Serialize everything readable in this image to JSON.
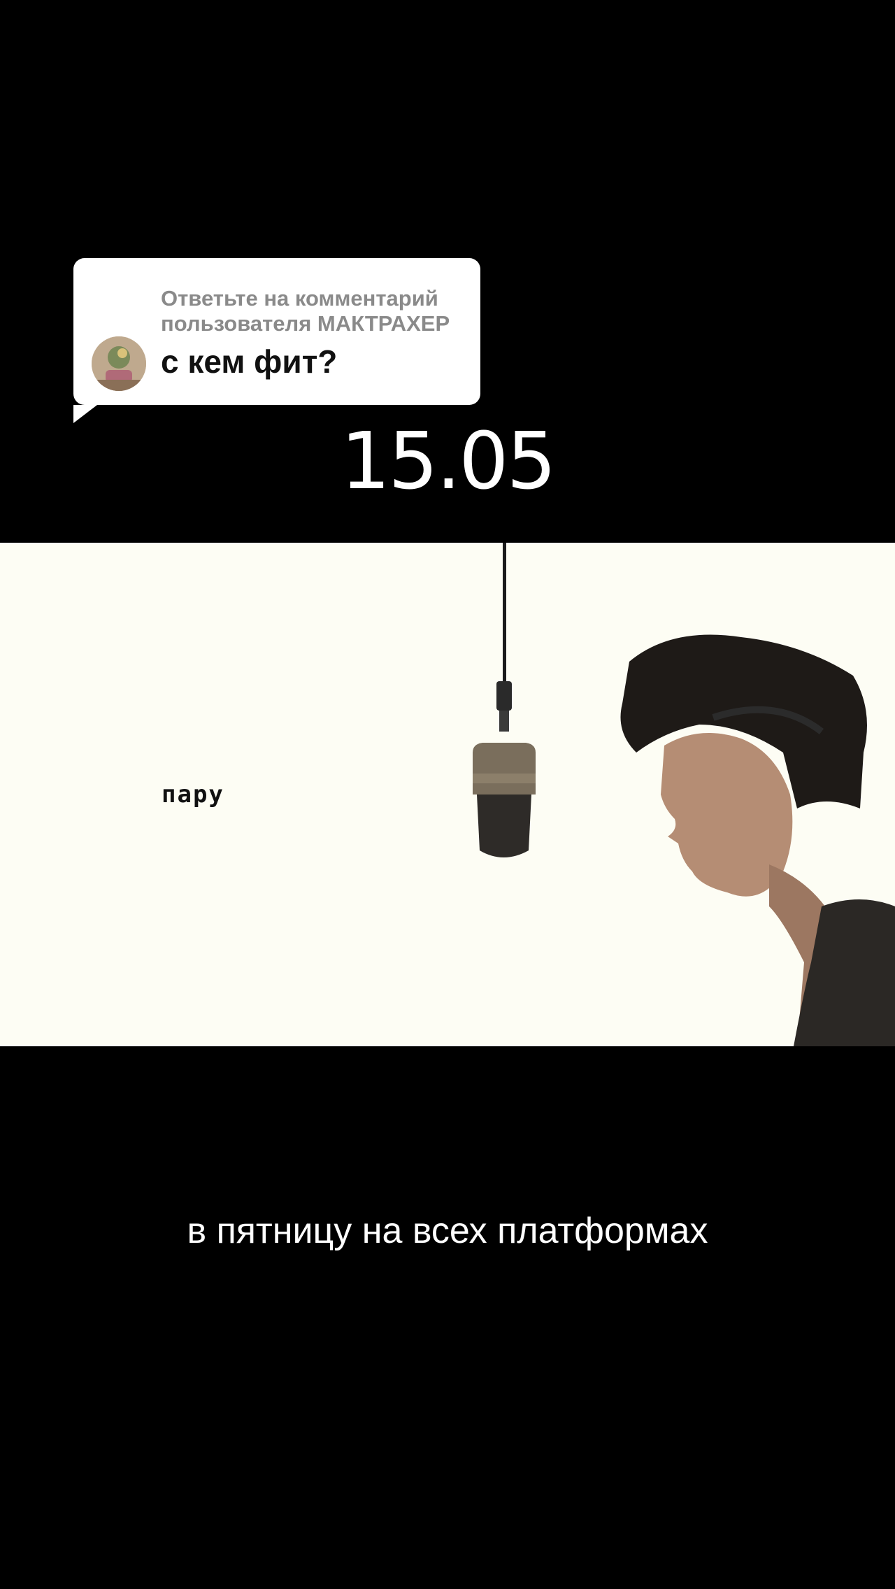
{
  "reply": {
    "header": "Ответьте на комментарий пользователя МАКТРАХЕР",
    "comment": "с кем фит?"
  },
  "overlay": {
    "date": "15.05"
  },
  "video": {
    "lyric": "пару"
  },
  "caption": {
    "text": "в пятницу на всех платформах"
  },
  "colors": {
    "background": "#000000",
    "bubble": "#ffffff",
    "video_background": "#fdfdf4"
  }
}
